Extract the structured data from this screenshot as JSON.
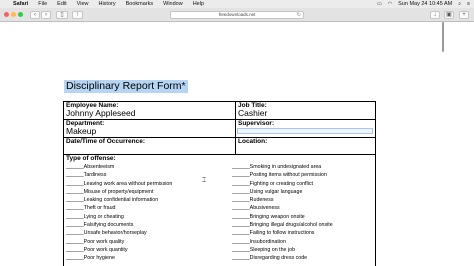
{
  "menubar": {
    "menus": [
      "Safari",
      "File",
      "Edit",
      "View",
      "History",
      "Bookmarks",
      "Window",
      "Help"
    ],
    "clock": "Sun May 24  10:45 AM"
  },
  "browser": {
    "url": "freedownloads.net"
  },
  "form": {
    "title": "Disciplinary Report Form*",
    "employee_name_label": "Employee Name:",
    "employee_name_value": "Johnny Appleseed",
    "job_title_label": "Job Title:",
    "job_title_value": "Cashier",
    "department_label": "Department:",
    "department_value": "Makeup",
    "supervisor_label": "Supervisor:",
    "date_time_label": "Date/Time of Occurrence:",
    "location_label": "Location:",
    "type_of_offense_label": "Type of offense:",
    "offenses_left": [
      "______Absenteeism",
      "______Tardiness",
      "______Leaving work area without permission",
      "______Misuse of property/equipment",
      "______Leaking confidential information",
      "______Theft or fraud",
      "______Lying or cheating",
      "______Falsifying documents",
      "______Unsafe behavior/horseplay",
      "______Poor work quality",
      "______Poor work quantity",
      "______Poor hygiene"
    ],
    "offenses_right": [
      "______Smoking in undesignated area",
      "______Posting items without permission",
      "______Fighting or creating conflict",
      "______Using vulgar language",
      "______Rudeness",
      "______Abusiveness",
      "______Bringing weapon onsite",
      "______Bringing illegal drugs/alcohol onsite",
      "______Failing to follow instructions",
      "______Insubordination",
      "______Sleeping on the job",
      "______Disregarding dress code"
    ]
  }
}
